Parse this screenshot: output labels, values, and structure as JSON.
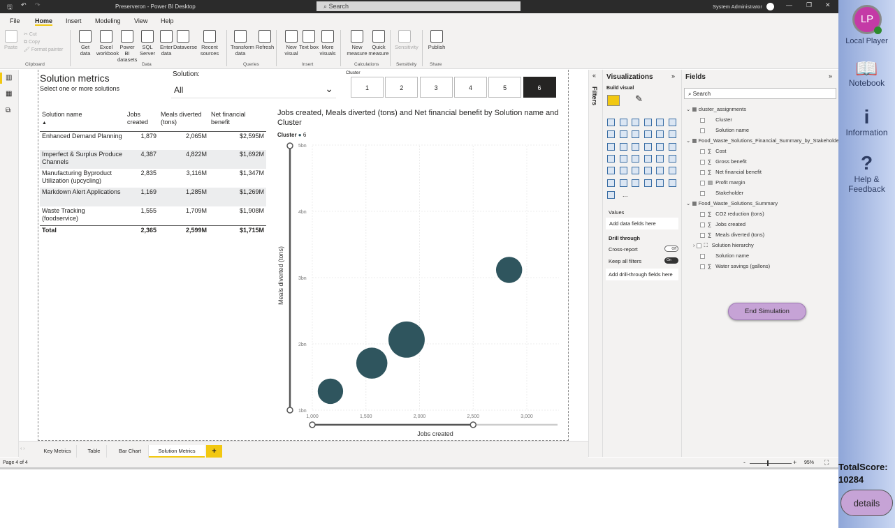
{
  "window": {
    "title": "Preserveron - Power BI Desktop",
    "search_placeholder": "Search",
    "user": "System Administrator"
  },
  "menu": [
    "File",
    "Home",
    "Insert",
    "Modeling",
    "View",
    "Help"
  ],
  "ribbon": {
    "clipboard": {
      "paste": "Paste",
      "cut": "Cut",
      "copy": "Copy",
      "format_painter": "Format painter",
      "group": "Clipboard"
    },
    "data": {
      "items": [
        "Get data",
        "Excel workbook",
        "Power BI datasets",
        "SQL Server",
        "Enter data",
        "Dataverse",
        "Recent sources"
      ],
      "group": "Data"
    },
    "queries": {
      "items": [
        "Transform data",
        "Refresh"
      ],
      "group": "Queries"
    },
    "insert": {
      "items": [
        "New visual",
        "Text box",
        "More visuals"
      ],
      "group": "Insert"
    },
    "calculations": {
      "items": [
        "New measure",
        "Quick measure"
      ],
      "group": "Calculations"
    },
    "sensitivity": {
      "items": [
        "Sensitivity"
      ],
      "group": "Sensitivity"
    },
    "share": {
      "items": [
        "Publish"
      ],
      "group": "Share"
    }
  },
  "report": {
    "title": "Solution metrics",
    "subtitle": "Select one or more solutions",
    "slicer": {
      "label": "Solution:",
      "value": "All"
    },
    "cluster": {
      "label": "Cluster",
      "options": [
        "1",
        "2",
        "3",
        "4",
        "5",
        "6"
      ],
      "selected": "6"
    },
    "table": {
      "headers": [
        "Solution name",
        "Jobs created",
        "Meals diverted (tons)",
        "Net financial benefit"
      ],
      "rows": [
        [
          "Enhanced Demand Planning",
          "1,879",
          "2,065M",
          "$2,595M"
        ],
        [
          "Imperfect & Surplus Produce Channels",
          "4,387",
          "4,822M",
          "$1,692M"
        ],
        [
          "Manufacturing Byproduct Utilization (upcycling)",
          "2,835",
          "3,116M",
          "$1,347M"
        ],
        [
          "Markdown Alert Applications",
          "1,169",
          "1,285M",
          "$1,269M"
        ],
        [
          "Waste Tracking (foodservice)",
          "1,555",
          "1,709M",
          "$1,908M"
        ]
      ],
      "total": [
        "Total",
        "2,365",
        "2,599M",
        "$1,715M"
      ]
    }
  },
  "chart_data": {
    "type": "scatter",
    "title": "Jobs created, Meals diverted (tons) and Net financial benefit by Solution name and Cluster",
    "legend_title": "Cluster",
    "legend": [
      "6"
    ],
    "xlabel": "Jobs created",
    "ylabel": "Meals diverted (tons)",
    "xlim": [
      1000,
      3300
    ],
    "ylim": [
      1,
      5
    ],
    "xticks": [
      "1,000",
      "1,500",
      "2,000",
      "2,500",
      "3,000"
    ],
    "yticks": [
      "1bn",
      "2bn",
      "3bn",
      "4bn",
      "5bn"
    ],
    "color": "#2f555e",
    "points": [
      {
        "label": "Enhanced Demand Planning",
        "x": 1879,
        "y": 2.065,
        "size": 2595
      },
      {
        "label": "Manufacturing Byproduct Utilization (upcycling)",
        "x": 2835,
        "y": 3.116,
        "size": 1347
      },
      {
        "label": "Markdown Alert Applications",
        "x": 1169,
        "y": 1.285,
        "size": 1269
      },
      {
        "label": "Waste Tracking (foodservice)",
        "x": 1555,
        "y": 1.709,
        "size": 1908
      }
    ]
  },
  "tabs": [
    "Key Metrics",
    "Table",
    "Bar Chart",
    "Solution Metrics"
  ],
  "active_tab": "Solution Metrics",
  "add_tab": "+",
  "status": {
    "page": "Page 4 of 4",
    "zoom": "95%"
  },
  "filters_label": "Filters",
  "viz": {
    "title": "Visualizations",
    "build": "Build visual",
    "values": "Values",
    "values_placeholder": "Add data fields here",
    "drill": "Drill through",
    "cross_report": "Cross-report",
    "cross_state": "Off",
    "keep_filters": "Keep all filters",
    "keep_state": "On",
    "drill_placeholder": "Add drill-through fields here",
    "more": "..."
  },
  "fields": {
    "title": "Fields",
    "search_placeholder": "Search",
    "tables": [
      {
        "name": "cluster_assignments",
        "fields": [
          {
            "n": "Cluster",
            "t": ""
          },
          {
            "n": "Solution name",
            "t": ""
          }
        ]
      },
      {
        "name": "Food_Waste_Solutions_Financial_Summary_by_Stakeholder",
        "fields": [
          {
            "n": "Cost",
            "t": "∑"
          },
          {
            "n": "Gross benefit",
            "t": "∑"
          },
          {
            "n": "Net financial benefit",
            "t": "∑"
          },
          {
            "n": "Profit margin",
            "t": "▤"
          },
          {
            "n": "Stakeholder",
            "t": ""
          }
        ]
      },
      {
        "name": "Food_Waste_Solutions_Summary",
        "fields": [
          {
            "n": "CO2 reduction (tons)",
            "t": "∑"
          },
          {
            "n": "Jobs created",
            "t": "∑"
          },
          {
            "n": "Meals diverted (tons)",
            "t": "∑"
          },
          {
            "n": "Solution hierarchy",
            "t": "⛶"
          },
          {
            "n": "Solution name",
            "t": ""
          },
          {
            "n": "Water savings (gallons)",
            "t": "∑"
          }
        ]
      }
    ]
  },
  "end_simulation": "End Simulation",
  "side": {
    "avatar": "LP",
    "user": "Local Player",
    "notebook": "Notebook",
    "information": "Information",
    "help": "Help & Feedback",
    "score_label": "TotalScore:",
    "score": "10284",
    "details": "details"
  }
}
